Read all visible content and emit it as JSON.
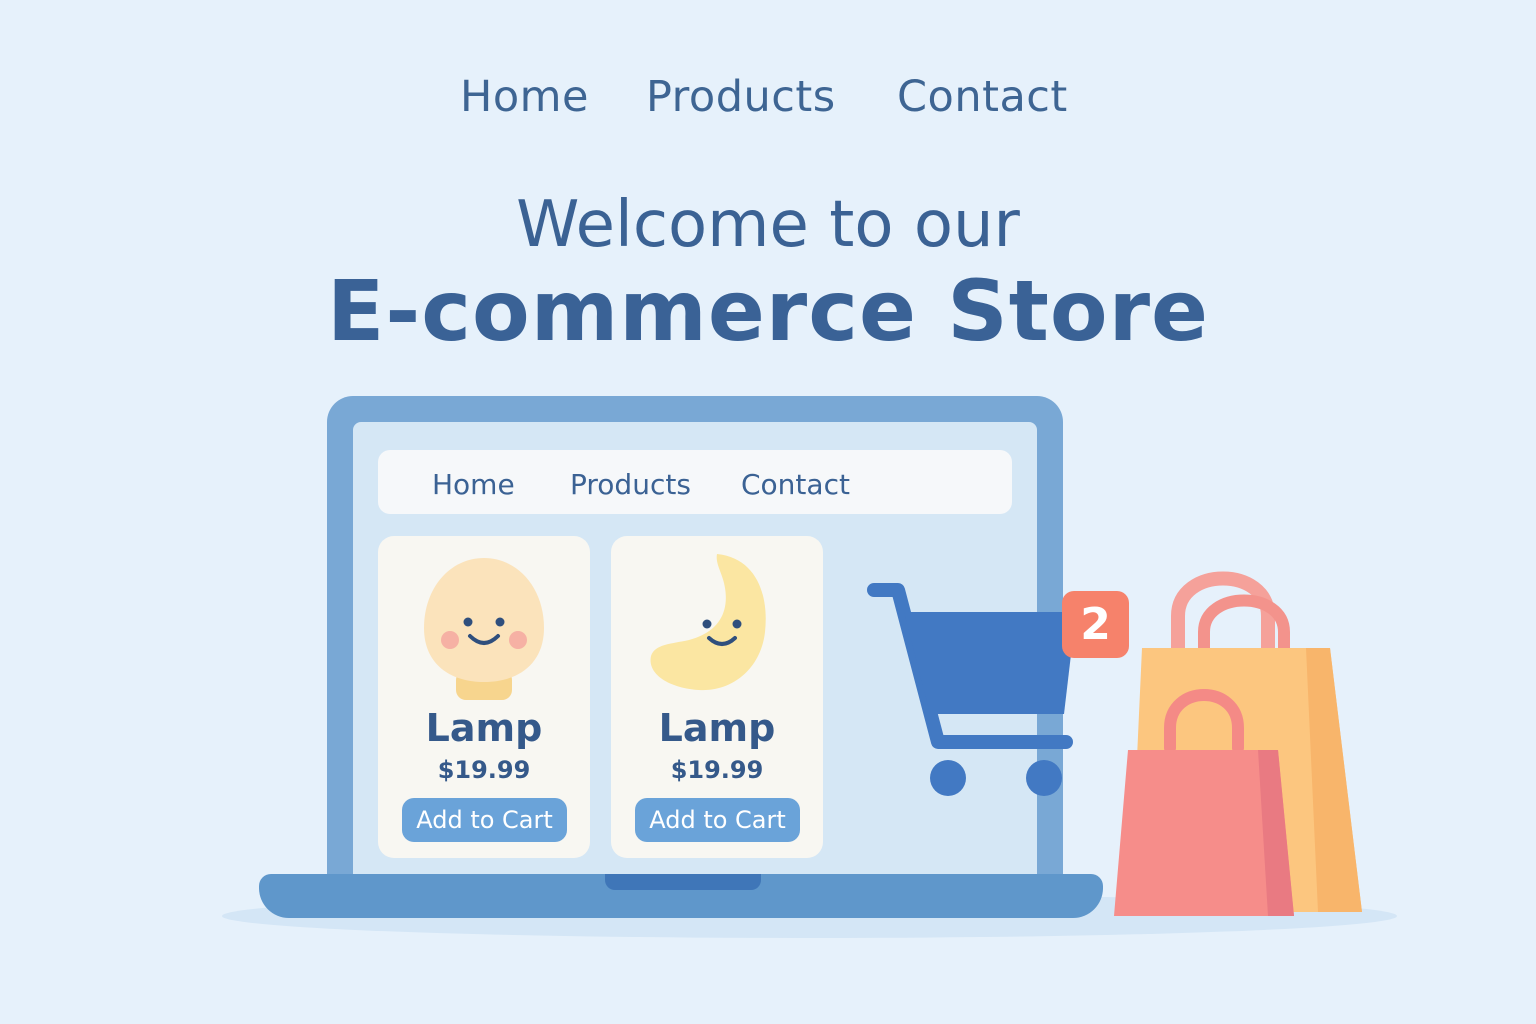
{
  "top_nav": {
    "items": [
      "Home",
      "Products",
      "Contact"
    ]
  },
  "hero": {
    "line1": "Welcome to our",
    "line2": "E-commerce Store"
  },
  "laptop": {
    "nav": {
      "items": [
        "Home",
        "Products",
        "Contact"
      ]
    },
    "products": [
      {
        "name": "Lamp",
        "price": "$19.99",
        "button": "Add to Cart",
        "art": "bulb-icon"
      },
      {
        "name": "Lamp",
        "price": "$19.99",
        "button": "Add to Cart",
        "art": "moon-icon"
      }
    ]
  },
  "cart": {
    "count": "2",
    "icon": "shopping-cart-icon"
  },
  "bags": {
    "icon": "shopping-bags-icon"
  },
  "colors": {
    "background": "#e6f1fb",
    "heading": "#3b6294",
    "button": "#6aa3d9",
    "cart": "#4279c3",
    "badge": "#f6826b"
  }
}
